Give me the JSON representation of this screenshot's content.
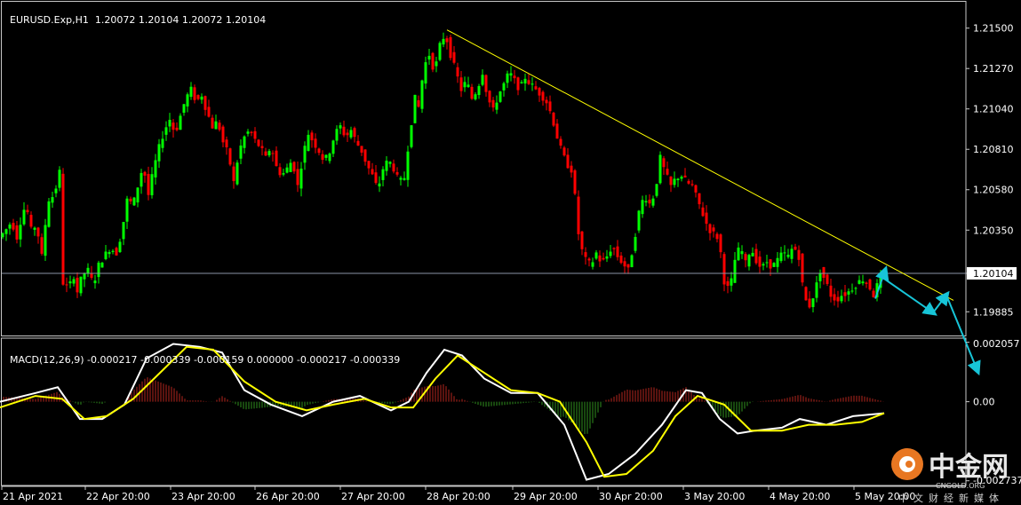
{
  "price_header": {
    "symbol": "EURUSD.Exp,H1",
    "ohlc": "1.20072 1.20104 1.20072 1.20104"
  },
  "macd_header": {
    "name": "MACD(12,26,9)",
    "values": "-0.000217 -0.000339 -0.000159 0.000000 -0.000217 -0.000339"
  },
  "watermark": {
    "name": "中金网",
    "url": "CNGOLD.ORG",
    "tagline": "中文财经新媒体"
  },
  "chart_data": [
    {
      "type": "candlestick",
      "title": "EURUSD.Exp,H1",
      "symbol": "EURUSD",
      "timeframe": "H1",
      "x_ticks": [
        "21 Apr 2021",
        "22 Apr 20:00",
        "23 Apr 20:00",
        "26 Apr 20:00",
        "27 Apr 20:00",
        "28 Apr 20:00",
        "29 Apr 20:00",
        "30 Apr 20:00",
        "3 May 20:00",
        "4 May 20:00",
        "5 May 20:00"
      ],
      "y_ticks": [
        1.19885,
        1.20104,
        1.2035,
        1.2058,
        1.2081,
        1.2104,
        1.2127,
        1.215
      ],
      "ylim": [
        1.1975,
        1.2165
      ],
      "current_price": 1.20104,
      "grid": false,
      "up_color": "#00ff00",
      "down_color": "#ff0000",
      "price_path": [
        [
          0,
          1.2031
        ],
        [
          6,
          1.2034
        ],
        [
          14,
          1.204
        ],
        [
          20,
          1.2031
        ],
        [
          25,
          1.2042
        ],
        [
          30,
          1.205
        ],
        [
          36,
          1.2035
        ],
        [
          42,
          1.2038
        ],
        [
          48,
          1.202
        ],
        [
          55,
          1.2052
        ],
        [
          62,
          1.2055
        ],
        [
          68,
          1.2068
        ],
        [
          72,
          1.2005
        ],
        [
          78,
          1.2002
        ],
        [
          84,
          1.2009
        ],
        [
          88,
          1.2
        ],
        [
          94,
          1.201
        ],
        [
          100,
          1.2012
        ],
        [
          106,
          1.2004
        ],
        [
          112,
          1.2015
        ],
        [
          118,
          1.202
        ],
        [
          125,
          1.2025
        ],
        [
          132,
          1.2022
        ],
        [
          138,
          1.2034
        ],
        [
          145,
          1.2055
        ],
        [
          150,
          1.2048
        ],
        [
          156,
          1.206
        ],
        [
          162,
          1.2072
        ],
        [
          168,
          1.2055
        ],
        [
          174,
          1.207
        ],
        [
          180,
          1.2082
        ],
        [
          186,
          1.2092
        ],
        [
          192,
          1.2098
        ],
        [
          198,
          1.209
        ],
        [
          204,
          1.21
        ],
        [
          210,
          1.211
        ],
        [
          216,
          1.2115
        ],
        [
          222,
          1.2108
        ],
        [
          228,
          1.2112
        ],
        [
          234,
          1.2102
        ],
        [
          240,
          1.2094
        ],
        [
          246,
          1.2097
        ],
        [
          252,
          1.2085
        ],
        [
          258,
          1.2078
        ],
        [
          264,
          1.2062
        ],
        [
          270,
          1.208
        ],
        [
          276,
          1.2088
        ],
        [
          282,
          1.2092
        ],
        [
          288,
          1.2086
        ],
        [
          294,
          1.2082
        ],
        [
          300,
          1.2076
        ],
        [
          306,
          1.2083
        ],
        [
          312,
          1.2071
        ],
        [
          318,
          1.2066
        ],
        [
          324,
          1.207
        ],
        [
          330,
          1.2075
        ],
        [
          336,
          1.206
        ],
        [
          342,
          1.2078
        ],
        [
          348,
          1.209
        ],
        [
          354,
          1.2085
        ],
        [
          360,
          1.208
        ],
        [
          366,
          1.2074
        ],
        [
          372,
          1.208
        ],
        [
          378,
          1.209
        ],
        [
          384,
          1.2094
        ],
        [
          390,
          1.2088
        ],
        [
          396,
          1.2092
        ],
        [
          402,
          1.2085
        ],
        [
          408,
          1.208
        ],
        [
          414,
          1.2072
        ],
        [
          420,
          1.2066
        ],
        [
          426,
          1.2058
        ],
        [
          432,
          1.207
        ],
        [
          438,
          1.2075
        ],
        [
          444,
          1.207
        ],
        [
          450,
          1.2062
        ],
        [
          456,
          1.2065
        ],
        [
          462,
          1.209
        ],
        [
          468,
          1.211
        ],
        [
          472,
          1.2105
        ],
        [
          478,
          1.2128
        ],
        [
          484,
          1.2135
        ],
        [
          490,
          1.2125
        ],
        [
          496,
          1.214
        ],
        [
          502,
          1.2147
        ],
        [
          508,
          1.2135
        ],
        [
          514,
          1.2125
        ],
        [
          520,
          1.2115
        ],
        [
          526,
          1.212
        ],
        [
          532,
          1.211
        ],
        [
          538,
          1.2115
        ],
        [
          544,
          1.2125
        ],
        [
          550,
          1.211
        ],
        [
          556,
          1.2103
        ],
        [
          562,
          1.2112
        ],
        [
          568,
          1.2118
        ],
        [
          574,
          1.2125
        ],
        [
          580,
          1.212
        ],
        [
          586,
          1.2115
        ],
        [
          592,
          1.2122
        ],
        [
          598,
          1.2118
        ],
        [
          604,
          1.2115
        ],
        [
          610,
          1.2112
        ],
        [
          616,
          1.2108
        ],
        [
          622,
          1.21
        ],
        [
          628,
          1.2088
        ],
        [
          634,
          1.2078
        ],
        [
          640,
          1.2072
        ],
        [
          646,
          1.2068
        ],
        [
          650,
          1.204
        ],
        [
          654,
          1.2026
        ],
        [
          660,
          1.2018
        ],
        [
          666,
          1.2015
        ],
        [
          672,
          1.2022
        ],
        [
          678,
          1.2016
        ],
        [
          684,
          1.202
        ],
        [
          690,
          1.2026
        ],
        [
          696,
          1.202
        ],
        [
          702,
          1.2016
        ],
        [
          708,
          1.2012
        ],
        [
          714,
          1.2027
        ],
        [
          720,
          1.2045
        ],
        [
          726,
          1.2055
        ],
        [
          732,
          1.205
        ],
        [
          738,
          1.2056
        ],
        [
          744,
          1.2076
        ],
        [
          750,
          1.2067
        ],
        [
          756,
          1.206
        ],
        [
          762,
          1.2065
        ],
        [
          768,
          1.2066
        ],
        [
          774,
          1.2062
        ],
        [
          780,
          1.206
        ],
        [
          786,
          1.2052
        ],
        [
          792,
          1.2044
        ],
        [
          798,
          1.2036
        ],
        [
          804,
          1.2033
        ],
        [
          810,
          1.203
        ],
        [
          816,
          1.2006
        ],
        [
          822,
          1.2
        ],
        [
          828,
          1.2018
        ],
        [
          834,
          1.2026
        ],
        [
          840,
          1.2016
        ],
        [
          846,
          1.2025
        ],
        [
          852,
          1.2018
        ],
        [
          858,
          1.2013
        ],
        [
          864,
          1.2017
        ],
        [
          870,
          1.2014
        ],
        [
          876,
          1.2018
        ],
        [
          882,
          1.2022
        ],
        [
          888,
          1.202
        ],
        [
          894,
          1.2026
        ],
        [
          900,
          1.202
        ],
        [
          906,
          1.1996
        ],
        [
          912,
          1.1992
        ],
        [
          918,
          1.2
        ],
        [
          924,
          1.2012
        ],
        [
          930,
          1.2006
        ],
        [
          936,
          1.1998
        ],
        [
          942,
          1.1995
        ],
        [
          948,
          1.1998
        ],
        [
          954,
          1.1999
        ],
        [
          960,
          1.2002
        ],
        [
          966,
          1.2005
        ],
        [
          972,
          1.2007
        ],
        [
          978,
          1.2004
        ],
        [
          984,
          1.1998
        ],
        [
          990,
          1.2006
        ],
        [
          994,
          1.201
        ]
      ],
      "trendline": {
        "from": [
          503,
          1.2149
        ],
        "to": [
          1073,
          1.1995
        ],
        "color": "#ffff00"
      },
      "forecast_arrows": {
        "color": "#17c5d8",
        "path": [
          [
            993,
            1.2008
          ],
          [
            1050,
            1.1988
          ],
          [
            1065,
            1.1998
          ],
          [
            1100,
            1.1955
          ]
        ]
      }
    },
    {
      "type": "macd",
      "title": "MACD(12,26,9)",
      "parameters": [
        12,
        26,
        9
      ],
      "y_ticks": [
        0.002057,
        0.0,
        -0.002737
      ],
      "ylim": [
        -0.0029,
        0.0022
      ],
      "series": [
        {
          "name": "main",
          "color": "#ffffff",
          "points": [
            [
              0,
              0.0
            ],
            [
              40,
              0.0003
            ],
            [
              65,
              0.0005
            ],
            [
              90,
              -0.0006
            ],
            [
              115,
              -0.0006
            ],
            [
              140,
              -0.0001
            ],
            [
              165,
              0.0015
            ],
            [
              195,
              0.002
            ],
            [
              225,
              0.0019
            ],
            [
              250,
              0.0017
            ],
            [
              275,
              0.0004
            ],
            [
              305,
              -0.0001
            ],
            [
              340,
              -0.0005
            ],
            [
              375,
              0.0
            ],
            [
              405,
              0.0002
            ],
            [
              440,
              -0.0003
            ],
            [
              460,
              0.0
            ],
            [
              480,
              0.001
            ],
            [
              500,
              0.0018
            ],
            [
              520,
              0.0016
            ],
            [
              545,
              0.0008
            ],
            [
              575,
              0.0003
            ],
            [
              605,
              0.0003
            ],
            [
              635,
              -0.0008
            ],
            [
              660,
              -0.0027
            ],
            [
              685,
              -0.0025
            ],
            [
              715,
              -0.0018
            ],
            [
              745,
              -0.0008
            ],
            [
              772,
              0.0004
            ],
            [
              790,
              0.0003
            ],
            [
              810,
              -0.0006
            ],
            [
              830,
              -0.0011
            ],
            [
              850,
              -0.001
            ],
            [
              880,
              -0.0009
            ],
            [
              900,
              -0.0006
            ],
            [
              930,
              -0.0008
            ],
            [
              960,
              -0.0005
            ],
            [
              995,
              -0.0004
            ]
          ]
        },
        {
          "name": "signal",
          "color": "#ffff00",
          "points": [
            [
              0,
              -0.0002
            ],
            [
              40,
              0.0002
            ],
            [
              70,
              0.0001
            ],
            [
              95,
              -0.0006
            ],
            [
              120,
              -0.0005
            ],
            [
              150,
              0.0001
            ],
            [
              180,
              0.001
            ],
            [
              210,
              0.0019
            ],
            [
              240,
              0.0018
            ],
            [
              275,
              0.0007
            ],
            [
              310,
              0.0
            ],
            [
              345,
              -0.0003
            ],
            [
              375,
              -0.0001
            ],
            [
              410,
              0.0001
            ],
            [
              440,
              -0.0002
            ],
            [
              465,
              -0.0002
            ],
            [
              490,
              0.0008
            ],
            [
              515,
              0.0016
            ],
            [
              545,
              0.001
            ],
            [
              575,
              0.0004
            ],
            [
              605,
              0.0003
            ],
            [
              630,
              0.0
            ],
            [
              660,
              -0.0014
            ],
            [
              680,
              -0.0026
            ],
            [
              705,
              -0.0025
            ],
            [
              735,
              -0.0017
            ],
            [
              760,
              -0.0005
            ],
            [
              785,
              0.0002
            ],
            [
              815,
              -0.0001
            ],
            [
              845,
              -0.001
            ],
            [
              880,
              -0.001
            ],
            [
              910,
              -0.0008
            ],
            [
              940,
              -0.0008
            ],
            [
              970,
              -0.0007
            ],
            [
              995,
              -0.0004
            ]
          ]
        },
        {
          "name": "histogram",
          "positive_color": "#b3261e",
          "negative_color": "#2f8f1e",
          "note_units": "bar heights follow main - signal"
        }
      ]
    }
  ]
}
